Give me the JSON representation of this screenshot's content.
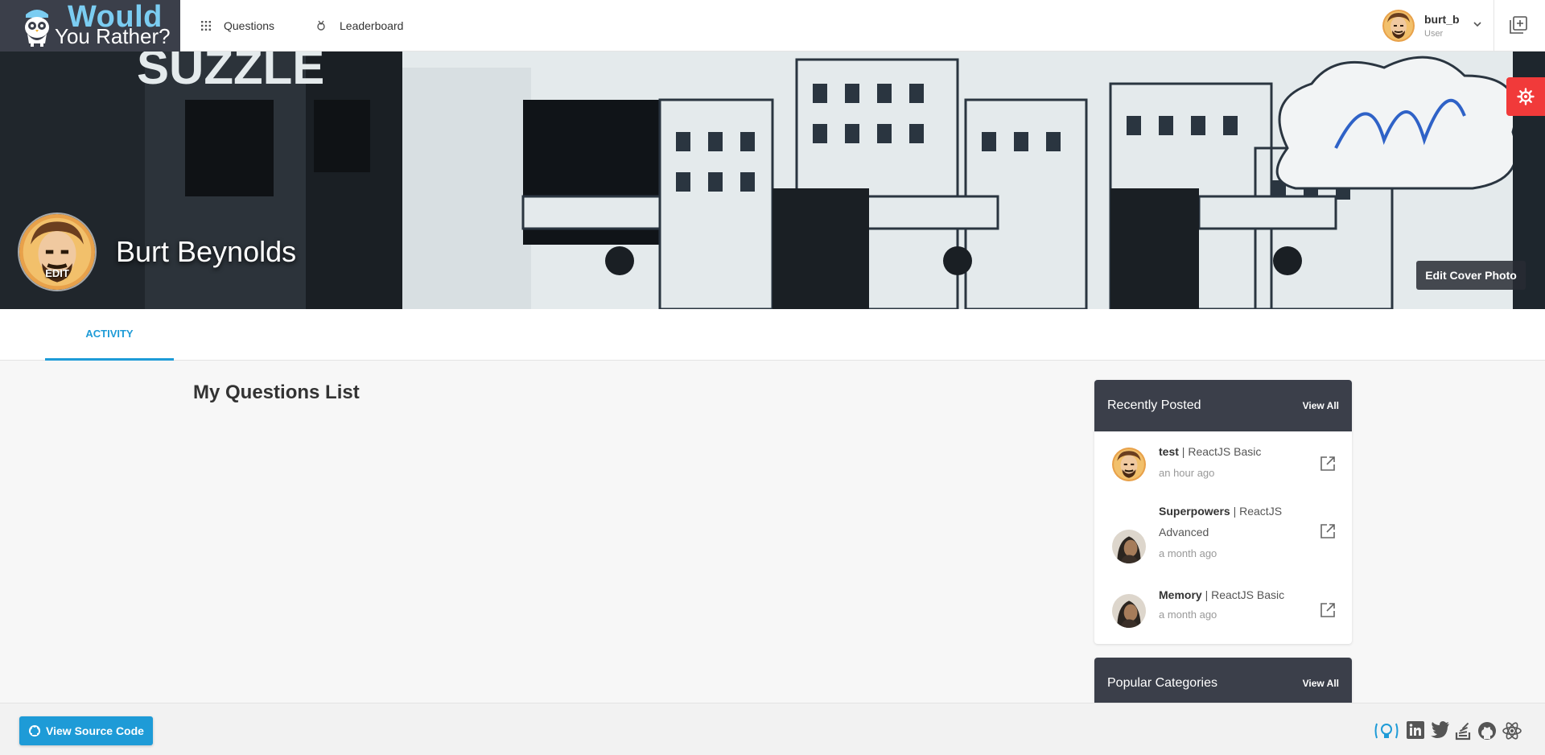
{
  "brand": {
    "line1": "Would",
    "line2": "You Rather?"
  },
  "nav": {
    "questions": "Questions",
    "leaderboard": "Leaderboard"
  },
  "user": {
    "username": "burt_b",
    "role": "User"
  },
  "cover": {
    "profile_name": "Burt Beynolds",
    "avatar_edit_label": "EDIT",
    "edit_cover_label": "Edit Cover Photo"
  },
  "tabs": {
    "activity": "ACTIVITY"
  },
  "main": {
    "title": "My Questions List"
  },
  "recently_posted": {
    "title": "Recently Posted",
    "view_all": "View All",
    "items": [
      {
        "name": "test",
        "category": "ReactJS Basic",
        "time": "an hour ago"
      },
      {
        "name": "Superpowers",
        "category": "ReactJS Advanced",
        "time": "a month ago"
      },
      {
        "name": "Memory",
        "category": "ReactJS Basic",
        "time": "a month ago"
      }
    ]
  },
  "popular_categories": {
    "title": "Popular Categories",
    "view_all": "View All"
  },
  "footer": {
    "source_button": "View Source Code"
  },
  "social_icons": [
    "lightbulb-icon",
    "linkedin-icon",
    "twitter-icon",
    "stackoverflow-icon",
    "github-icon",
    "react-icon"
  ],
  "colors": {
    "accent": "#1e9bd7",
    "dark": "#3b3f4a",
    "gear_tab": "#f13a3a",
    "brand_blue": "#7bcdf2"
  }
}
